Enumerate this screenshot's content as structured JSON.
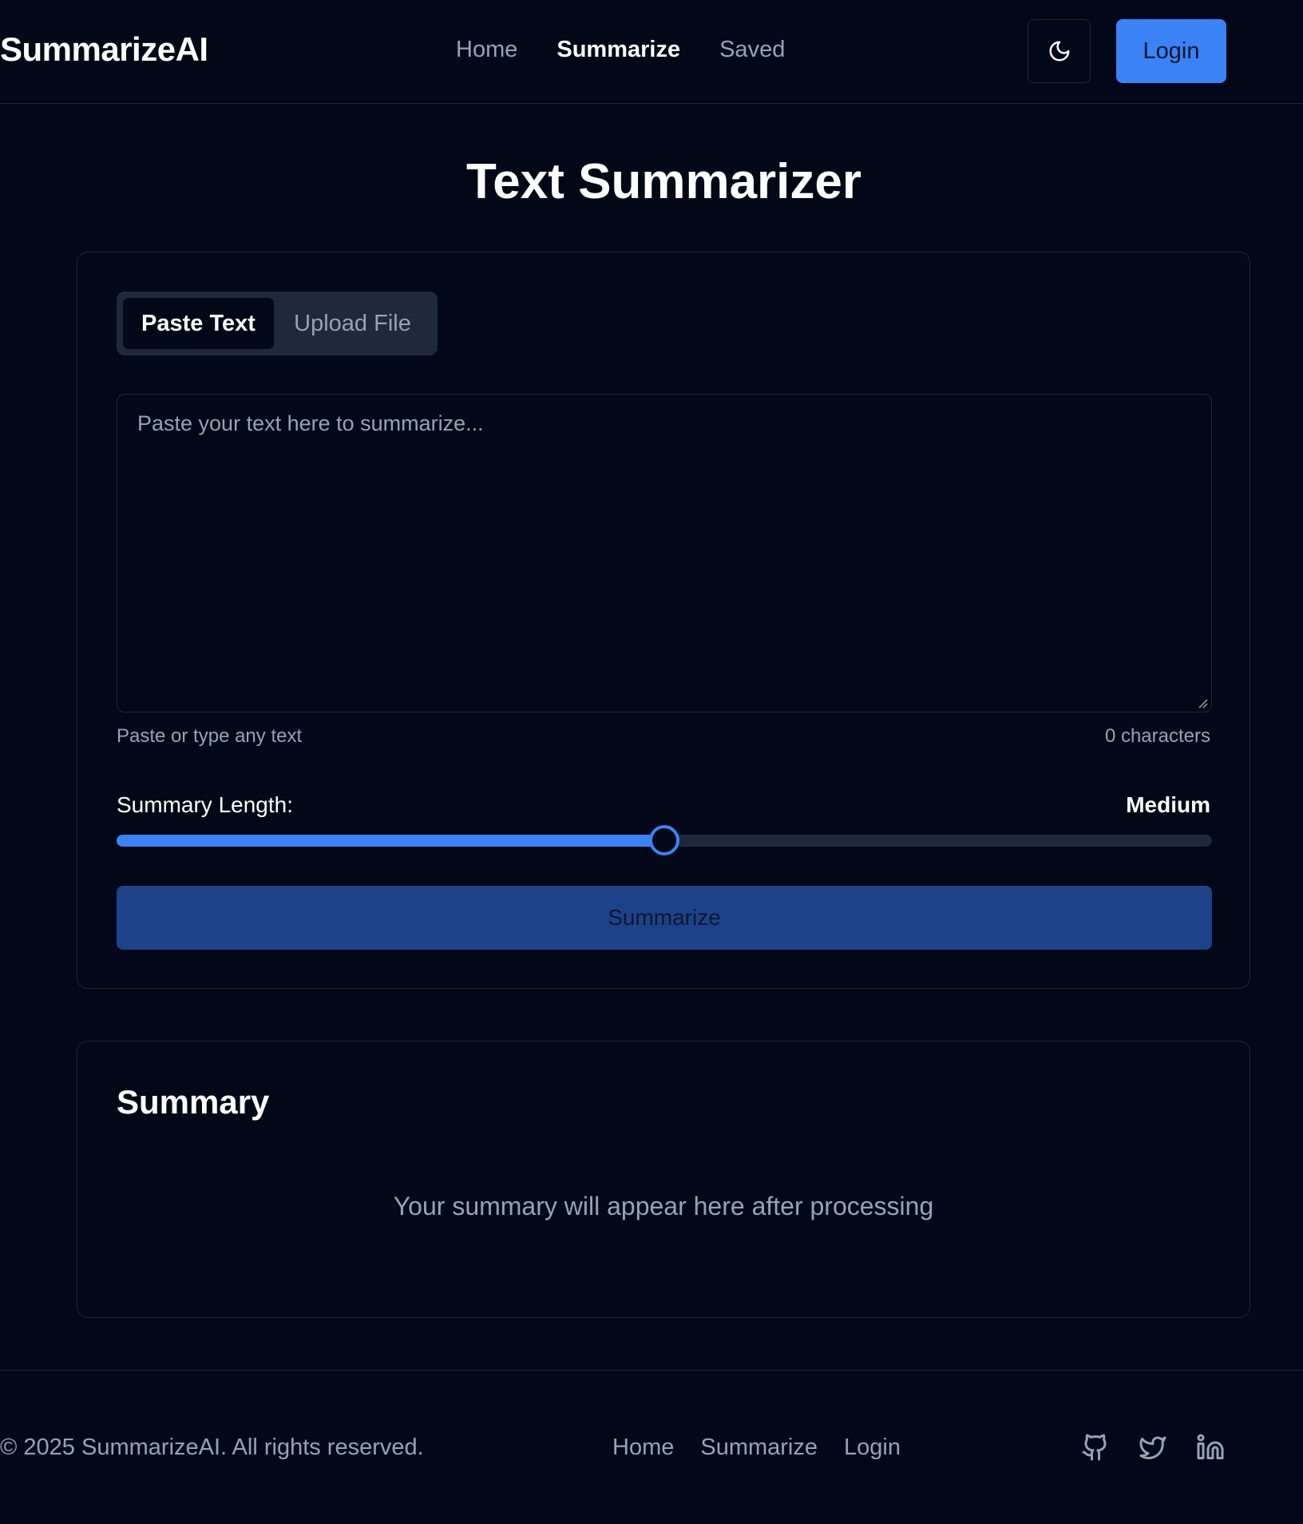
{
  "header": {
    "logo": "SummarizeAI",
    "nav": [
      {
        "label": "Home",
        "active": false
      },
      {
        "label": "Summarize",
        "active": true
      },
      {
        "label": "Saved",
        "active": false
      }
    ],
    "theme_icon": "moon-icon",
    "login_label": "Login"
  },
  "main": {
    "title": "Text Summarizer",
    "tabs": [
      {
        "label": "Paste Text",
        "active": true
      },
      {
        "label": "Upload File",
        "active": false
      }
    ],
    "textarea": {
      "placeholder": "Paste your text here to summarize...",
      "value": ""
    },
    "hint_left": "Paste or type any text",
    "hint_right": "0 characters",
    "length_label": "Summary Length:",
    "length_value": "Medium",
    "slider_level_percent": 50,
    "summarize_label": "Summarize"
  },
  "summary": {
    "title": "Summary",
    "placeholder": "Your summary will appear here after processing"
  },
  "footer": {
    "copyright": "© 2025 SummarizeAI. All rights reserved.",
    "links": [
      "Home",
      "Summarize",
      "Login"
    ],
    "social_icons": [
      "github-icon",
      "twitter-icon",
      "linkedin-icon"
    ]
  },
  "colors": {
    "background": "#020817",
    "border": "#1e293b",
    "accent": "#3b82f6",
    "button_disabled": "#1e4289",
    "muted_text": "#94a3b8"
  }
}
